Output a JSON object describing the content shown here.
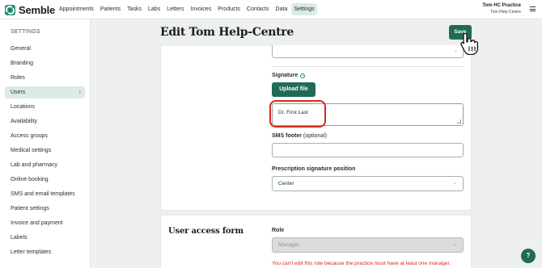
{
  "app": {
    "brand": "Semble"
  },
  "nav": {
    "items": [
      "Appointments",
      "Patients",
      "Tasks",
      "Labs",
      "Letters",
      "Invoices",
      "Products",
      "Contacts",
      "Data",
      "Settings"
    ],
    "active": "Settings"
  },
  "account": {
    "practice": "Tom HC Practice",
    "user": "Tom Help-Centre"
  },
  "sidebar": {
    "heading": "SETTINGS",
    "items": [
      "General",
      "Branding",
      "Roles",
      "Users",
      "Locations",
      "Availability",
      "Access groups",
      "Medical settings",
      "Lab and pharmacy",
      "Online booking",
      "SMS and email templates",
      "Patient settings",
      "Invoice and payment",
      "Labels",
      "Letter templates"
    ],
    "active": "Users"
  },
  "page": {
    "title": "Edit Tom Help-Centre",
    "save_label": "Save"
  },
  "form": {
    "signature_label": "Signature",
    "upload_label": "Upload file",
    "signature_text": "Dr. First Last",
    "sms_footer_label": "SMS footer",
    "sms_footer_optional": "(optional)",
    "sms_footer_value": "",
    "prescription_position_label": "Prescription signature position",
    "prescription_position_value": "Center"
  },
  "access_form": {
    "title": "User access form",
    "role_label": "Role",
    "role_value": "Manager",
    "role_error": "You can't edit this role because the practice must have at least one manager."
  },
  "help": {
    "label": "?"
  },
  "colors": {
    "accent": "#1f6b58",
    "active_bg": "#dcebe6",
    "error": "#d52b1e",
    "highlight": "#d52b1e"
  }
}
